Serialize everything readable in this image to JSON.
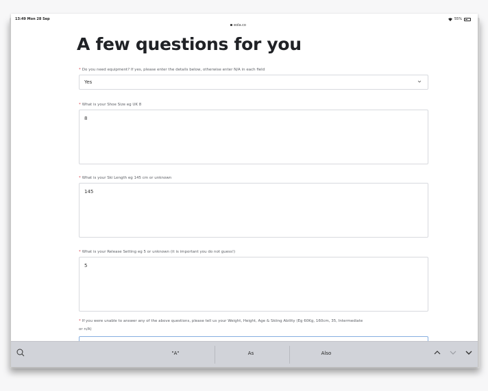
{
  "status": {
    "time": "13:49  Mon 28 Sep",
    "url": "eola.co",
    "battery": "55%"
  },
  "page": {
    "title": "A few questions for you"
  },
  "fields": {
    "equipment": {
      "label": "Do you need equipment? If yes, please enter the details below, otherwise enter N/A in each field",
      "value": "Yes"
    },
    "shoe": {
      "label": "What is your Shoe Size eg UK 8",
      "value": "8"
    },
    "ski": {
      "label": "What is your Ski Length eg 145 cm or unknown",
      "value": "145"
    },
    "release": {
      "label": "What is your Release Setting eg 5 or unknown (it is important you do not guess!)",
      "value": "5"
    },
    "extra": {
      "label_line1": "If you were unable to answer any of the above questions, please tell us your Weight, Height, Age & Skiing Ability (Eg 60Kg, 160cm, 35, Intermediate",
      "label_line2": "or n/A)"
    }
  },
  "required_mark": "*",
  "keyboard": {
    "suggestions": [
      "\"A\"",
      "As",
      "Also"
    ]
  },
  "icons": [
    "lock-icon",
    "wifi-icon",
    "battery-icon",
    "chevron-down-icon",
    "keyboard-toggle-icon",
    "chevron-up-icon",
    "chevron-down-icon",
    "dismiss-keyboard-icon"
  ]
}
